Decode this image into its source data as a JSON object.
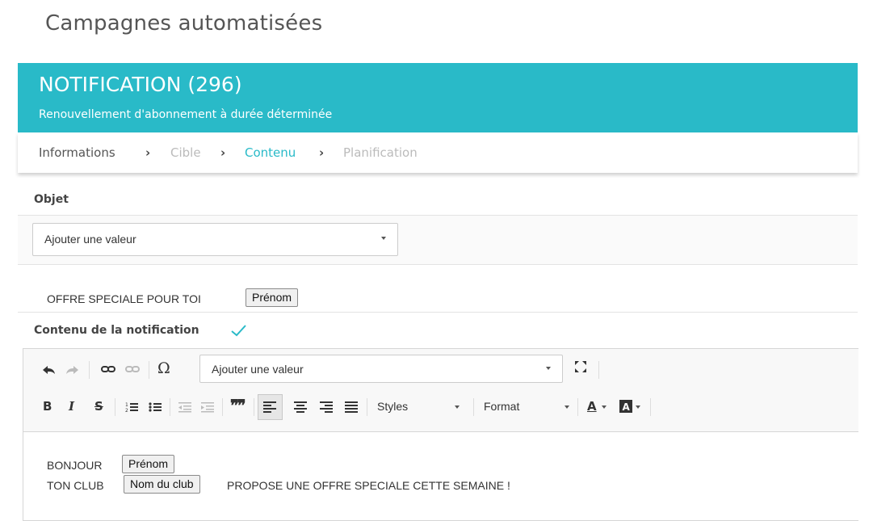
{
  "page": {
    "title": "Campagnes automatisées"
  },
  "banner": {
    "title": "NOTIFICATION (296)",
    "subtitle": "Renouvellement d'abonnement à durée déterminée",
    "color": "#29bac8"
  },
  "steps": [
    {
      "label": "Informations",
      "state": "done"
    },
    {
      "label": "Cible",
      "state": "disabled"
    },
    {
      "label": "Contenu",
      "state": "current"
    },
    {
      "label": "Planification",
      "state": "disabled"
    }
  ],
  "objet": {
    "label": "Objet",
    "select_value": "Ajouter une valeur",
    "preview_text": "OFFRE SPECIALE POUR TOI",
    "preview_chip": "Prénom"
  },
  "contenu": {
    "label": "Contenu de la notification",
    "toolbar": {
      "insert_select_value": "Ajouter une valeur",
      "styles_label": "Styles",
      "format_label": "Format",
      "bold": "B",
      "italic": "I",
      "strike": "S",
      "quote": "99",
      "omega": "Ω",
      "font_color": "A"
    },
    "body": {
      "line1_text": "BONJOUR",
      "line1_chip": "Prénom",
      "line2_text": "TON CLUB",
      "line2_chip": "Nom du club",
      "line2_rest": "PROPOSE UNE OFFRE SPECIALE CETTE SEMAINE !"
    }
  }
}
